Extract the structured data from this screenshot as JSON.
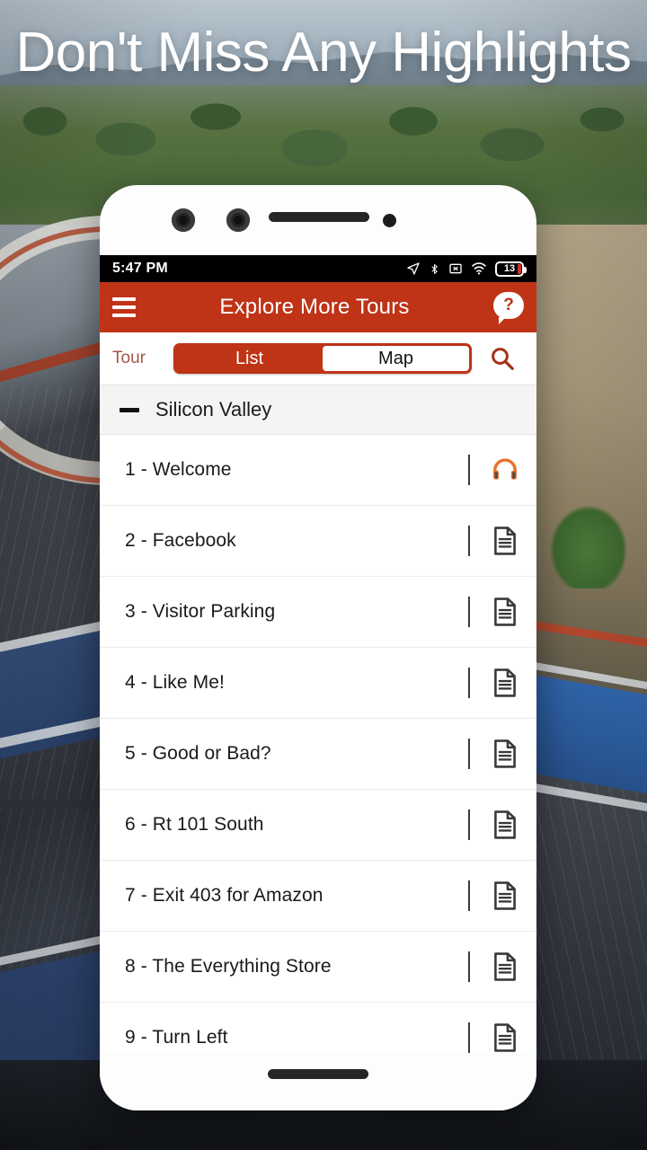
{
  "headline": "Don't Miss Any Highlights",
  "colors": {
    "brand_red": "#bf3317",
    "tour_label": "#a8544a",
    "headphone_orange": "#e8732a",
    "doc_icon": "#3a3a3a"
  },
  "phone": {
    "camera_icon": "camera-lens",
    "speaker_icon": "speaker-grille",
    "sensor_icon": "proximity-sensor"
  },
  "status_bar": {
    "time": "5:47 PM",
    "icons": [
      "location-arrow-icon",
      "bluetooth-icon",
      "no-sim-icon",
      "wifi-icon"
    ],
    "battery_level": "13"
  },
  "app_bar": {
    "menu_icon": "hamburger-menu-icon",
    "title": "Explore More Tours",
    "help_icon": "help-bubble-icon",
    "help_glyph": "?"
  },
  "segment_row": {
    "label": "Tour",
    "options": [
      {
        "label": "List",
        "selected": true
      },
      {
        "label": "Map",
        "selected": false
      }
    ],
    "search_icon": "search-icon"
  },
  "group": {
    "collapse_icon": "minus-collapse-icon",
    "title": "Silicon Valley"
  },
  "list": {
    "items": [
      {
        "title": "1 - Welcome",
        "icon": "headphones-icon"
      },
      {
        "title": "2 - Facebook",
        "icon": "document-icon"
      },
      {
        "title": "3 - Visitor Parking",
        "icon": "document-icon"
      },
      {
        "title": "4 - Like Me!",
        "icon": "document-icon"
      },
      {
        "title": "5 - Good or Bad?",
        "icon": "document-icon"
      },
      {
        "title": "6 - Rt 101 South",
        "icon": "document-icon"
      },
      {
        "title": "7 - Exit 403 for Amazon",
        "icon": "document-icon"
      },
      {
        "title": "8 - The Everything Store",
        "icon": "document-icon"
      },
      {
        "title": "9 - Turn Left",
        "icon": "document-icon"
      }
    ]
  }
}
